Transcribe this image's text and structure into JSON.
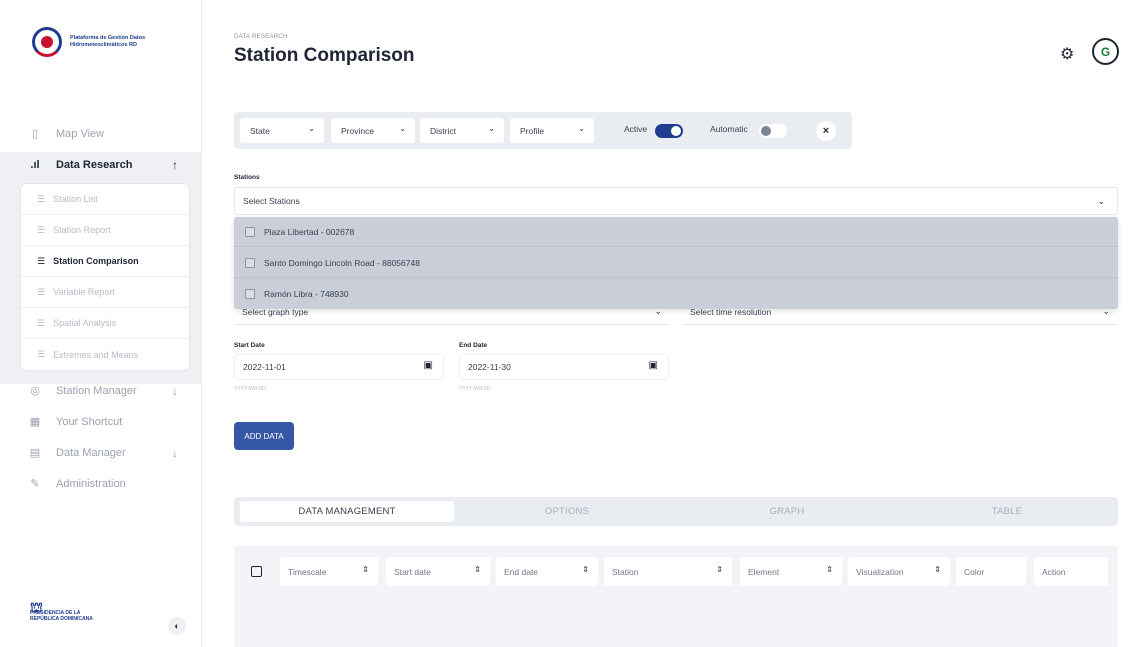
{
  "brand": {
    "name": "Plataforma de Gestión Datos Hidrometeoclimáticos RD",
    "footer": "REPÚBLICA DOMINICANA",
    "footer_small": "PRESIDENCIA DE LA"
  },
  "sidebar": {
    "items": [
      {
        "label": "Map View",
        "icon": "map-icon"
      },
      {
        "label": "Data Research",
        "icon": "bar-chart-icon",
        "arrow": "↑"
      },
      {
        "label": "Station Manager",
        "icon": "location-icon",
        "arrow": "↓"
      },
      {
        "label": "Your Shortcut",
        "icon": "grid-icon"
      },
      {
        "label": "Data Manager",
        "icon": "database-icon",
        "arrow": "↓"
      },
      {
        "label": "Administration",
        "icon": "tools-icon"
      }
    ],
    "subitems": [
      {
        "label": "Station List"
      },
      {
        "label": "Station Report"
      },
      {
        "label": "Station Comparison"
      },
      {
        "label": "Variable Report"
      },
      {
        "label": "Spatial Analysis"
      },
      {
        "label": "Extremes and Means"
      }
    ]
  },
  "header": {
    "eyebrow": "DATA RESEARCH",
    "title": "Station Comparison",
    "avatar_initial": "G"
  },
  "filters": {
    "state": "State",
    "province": "Province",
    "district": "District",
    "profile": "Profile",
    "active_label": "Active",
    "automatic_label": "Automatic",
    "close": "×"
  },
  "stations": {
    "label": "Stations",
    "placeholder": "Select Stations",
    "options": [
      "Plaza Libertad - 002678",
      "Santo Domingo Lincoln Road - 88056748",
      "Ramón Libra - 748930"
    ]
  },
  "graph": {
    "placeholder": "Select graph type",
    "resolution_placeholder": "Select time resolution"
  },
  "dates": {
    "start_label": "Start Date",
    "start_value": "2022-11-01",
    "end_label": "End Date",
    "end_value": "2022-11-30",
    "hint": "YYYY-MM-DD"
  },
  "add_button": "ADD DATA",
  "tabs": [
    "DATA MANAGEMENT",
    "OPTIONS",
    "GRAPH",
    "TABLE"
  ],
  "table": {
    "columns": [
      "Timescale",
      "Start date",
      "End date",
      "Station",
      "Element",
      "Visualization",
      "Color",
      "Action"
    ]
  },
  "colors": {
    "primary": "#1e3d8f",
    "button": "#3557a6",
    "accent_red": "#c8102e"
  }
}
